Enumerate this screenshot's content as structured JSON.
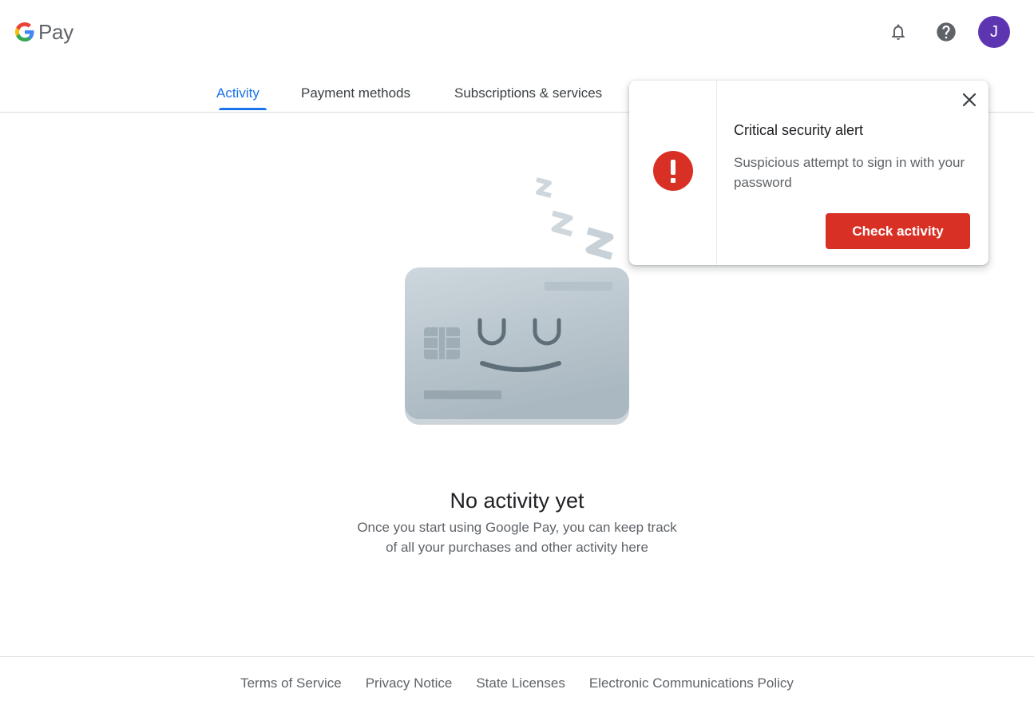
{
  "header": {
    "logo_text": "Pay",
    "avatar_initial": "J",
    "avatar_color": "#5e35b1"
  },
  "tabs": [
    {
      "label": "Activity",
      "active": true
    },
    {
      "label": "Payment methods",
      "active": false
    },
    {
      "label": "Subscriptions & services",
      "active": false
    }
  ],
  "empty_state": {
    "title": "No activity yet",
    "line1": "Once you start using Google Pay, you can keep track",
    "line2": "of all your purchases and other activity here"
  },
  "footer": {
    "links": [
      "Terms of Service",
      "Privacy Notice",
      "State Licenses",
      "Electronic Communications Policy"
    ]
  },
  "alert": {
    "title": "Critical security alert",
    "message": "Suspicious attempt to sign in with your password",
    "button": "Check activity",
    "accent_color": "#d93025"
  },
  "colors": {
    "primary": "#1a73e8",
    "danger": "#d93025",
    "text_secondary": "#5f6368"
  }
}
